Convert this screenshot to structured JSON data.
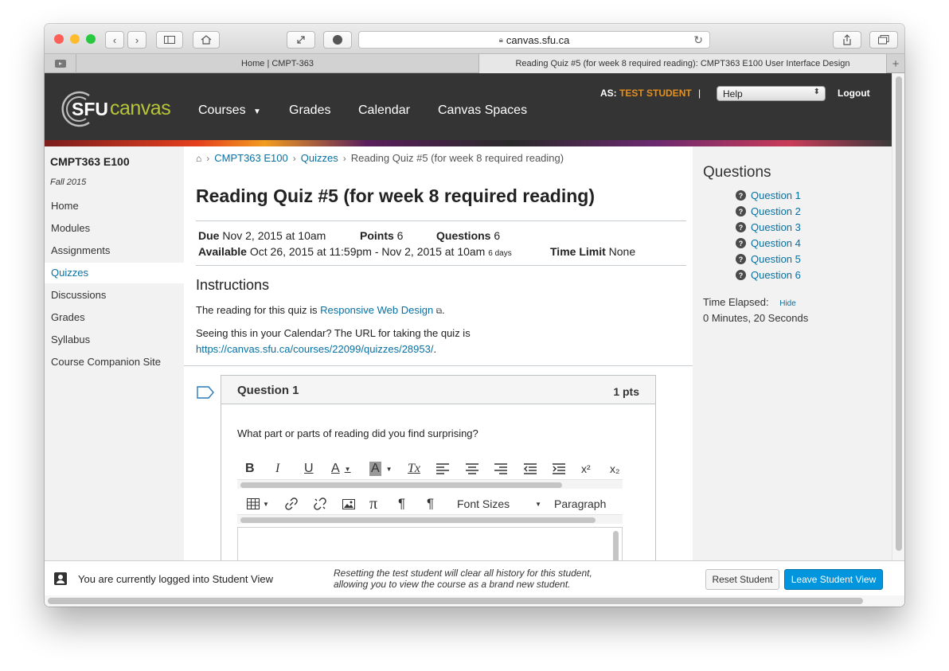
{
  "browser": {
    "address": "canvas.sfu.ca",
    "tabs": [
      {
        "label": "Home | CMPT-363"
      },
      {
        "label": "Reading Quiz #5 (for week 8 required reading): CMPT363 E100 User Interface Design"
      }
    ],
    "lights": {
      "close": "#fe5f57",
      "minimize": "#febc2e",
      "zoom": "#28c840"
    }
  },
  "header": {
    "logo_sfu": "SFU",
    "logo_canvas": "canvas",
    "nav": [
      {
        "label": "Courses"
      },
      {
        "label": "Grades"
      },
      {
        "label": "Calendar"
      },
      {
        "label": "Canvas Spaces"
      }
    ],
    "as_prefix": "AS:",
    "as_name": "TEST STUDENT",
    "pipe": "|",
    "help_label": "Help",
    "logout_label": "Logout"
  },
  "sidebar": {
    "course_title": "CMPT363 E100",
    "term": "Fall 2015",
    "items": [
      {
        "label": "Home"
      },
      {
        "label": "Modules"
      },
      {
        "label": "Assignments"
      },
      {
        "label": "Quizzes"
      },
      {
        "label": "Discussions"
      },
      {
        "label": "Grades"
      },
      {
        "label": "Syllabus"
      },
      {
        "label": "Course Companion Site"
      }
    ]
  },
  "main": {
    "breadcrumb": {
      "course": "CMPT363 E100",
      "section": "Quizzes",
      "current": "Reading Quiz #5 (for week 8 required reading)"
    },
    "title": "Reading Quiz #5 (for week 8 required reading)",
    "meta": {
      "due_label": "Due",
      "due_value": "Nov 2, 2015 at 10am",
      "points_label": "Points",
      "points_value": "6",
      "questions_label": "Questions",
      "questions_value": "6",
      "available_label": "Available",
      "available_value": "Oct 26, 2015 at 11:59pm - Nov 2, 2015 at 10am",
      "available_days": "6 days",
      "timelimit_label": "Time Limit",
      "timelimit_value": "None"
    },
    "instructions_heading": "Instructions",
    "instructions_p1_prefix": "The reading for this quiz is",
    "instructions_link": "Responsive Web Design",
    "instructions_p1_suffix": ".",
    "instructions_p2": "Seeing this in your Calendar? The URL for taking the quiz is",
    "instructions_url": "https://canvas.sfu.ca/courses/22099/quizzes/28953/",
    "instructions_url_suffix": "."
  },
  "question": {
    "title": "Question 1",
    "points": "1 pts",
    "text": "What part or parts of reading did you find surprising?",
    "toolbar_row1": [
      "B",
      "I",
      "U",
      "A",
      "A",
      "Tx",
      "align-left",
      "align-center",
      "align-right",
      "outdent",
      "indent",
      "x²",
      "x₂"
    ],
    "font_sizes_label": "Font Sizes",
    "paragraph_label": "Paragraph"
  },
  "right_panel": {
    "heading": "Questions",
    "questions": [
      {
        "label": "Question 1"
      },
      {
        "label": "Question 2"
      },
      {
        "label": "Question 3"
      },
      {
        "label": "Question 4"
      },
      {
        "label": "Question 5"
      },
      {
        "label": "Question 6"
      }
    ],
    "time_elapsed_label": "Time Elapsed:",
    "hide_label": "Hide",
    "time_elapsed_value": "0 Minutes, 20 Seconds"
  },
  "student_view": {
    "message": "You are currently logged into Student View",
    "note_line1": "Resetting the test student will clear all history for this student,",
    "note_line2": "allowing you to view the course as a brand new student.",
    "reset_label": "Reset Student",
    "leave_label": "Leave Student View"
  },
  "colors": {
    "link": "#0770a2",
    "accent_orange": "#e4901f",
    "header_bg": "#343434",
    "leave_button": "#0095dd"
  }
}
